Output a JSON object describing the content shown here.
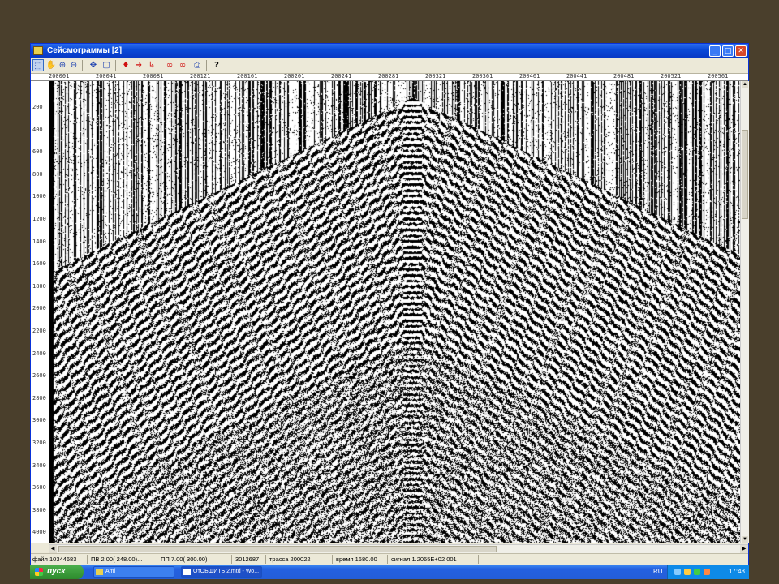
{
  "window": {
    "title": "Сейсмограммы [2]",
    "buttons": {
      "minimize": "_",
      "maximize": "□",
      "close": "✕"
    }
  },
  "toolbar": {
    "tools": [
      {
        "name": "select-tool",
        "glyph": "⬚"
      },
      {
        "name": "hand-tool",
        "glyph": "✋"
      },
      {
        "name": "zoom-in-tool",
        "glyph": "⊕"
      },
      {
        "name": "zoom-out-tool",
        "glyph": "⊖"
      },
      {
        "name": "zoom-fit-tool",
        "glyph": "⊙"
      },
      {
        "name": "crosshair-tool",
        "glyph": "✥"
      },
      {
        "name": "frame-tool",
        "glyph": "▢"
      },
      {
        "name": "pick-marker-tool",
        "glyph": "♦"
      },
      {
        "name": "arrow-right-tool",
        "glyph": "➜"
      },
      {
        "name": "arrow-down-tool",
        "glyph": "↳"
      },
      {
        "name": "glasses-tool",
        "glyph": "∞"
      },
      {
        "name": "glasses-alt-tool",
        "glyph": "∞"
      },
      {
        "name": "print-tool",
        "glyph": "⎙"
      },
      {
        "name": "help-tool",
        "glyph": "?"
      }
    ]
  },
  "ruler": {
    "ticks": [
      "200001",
      "200041",
      "200081",
      "200121",
      "200161",
      "200201",
      "200241",
      "200281",
      "200321",
      "200361",
      "200401",
      "200441",
      "200481",
      "200521",
      "200561"
    ]
  },
  "y_axis": {
    "labels": [
      "200",
      "400",
      "600",
      "800",
      "1000",
      "1200",
      "1400",
      "1600",
      "1800",
      "2000",
      "2200",
      "2400",
      "2600",
      "2800",
      "3000",
      "3200",
      "3400",
      "3600",
      "3800",
      "4000"
    ]
  },
  "status": {
    "file": "файл 10344683",
    "range": "ПВ 2.00( 248.00)...",
    "pos": "ПП 7.00( 300.00)",
    "value": "3012687",
    "trace": "трасса 200022",
    "time": "время 1680.00",
    "signal": "сигнал 1.2065E+02 001"
  },
  "taskbar": {
    "start_label": "пуск",
    "tasks": [
      "Ami",
      "ОтОБЩИТЬ 2.mtd - Wo..."
    ],
    "language": "RU",
    "clock": "17:48"
  },
  "colors": {
    "desktop": "#4a3f2c",
    "title_blue": "#0a4ad8",
    "start_green": "#2d8a2d"
  }
}
